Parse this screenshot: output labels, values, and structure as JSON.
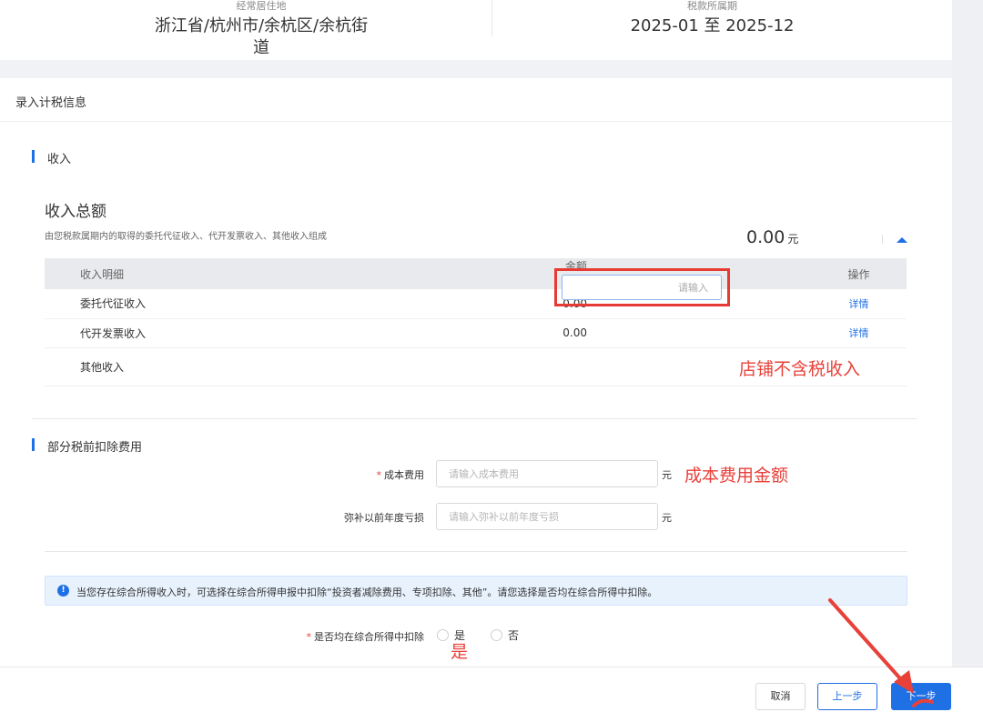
{
  "header": {
    "residence_label": "经常居住地",
    "residence_value": "浙江省/杭州市/余杭区/余杭街道",
    "period_label": "税款所属期",
    "period_value": "2025-01 至 2025-12"
  },
  "card": {
    "title": "录入计税信息"
  },
  "income": {
    "section_title": "收入",
    "total_title": "收入总额",
    "total_desc": "由您税款属期内的取得的委托代征收入、代开发票收入、其他收入组成",
    "total_amount": "0.00",
    "total_unit": "元",
    "table": {
      "headers": [
        "收入明细",
        "金额（元）",
        "操作"
      ],
      "rows": [
        {
          "name": "委托代征收入",
          "amount": "0.00",
          "action": "详情"
        },
        {
          "name": "代开发票收入",
          "amount": "0.00",
          "action": "详情"
        },
        {
          "name": "其他收入"
        }
      ],
      "other_input_placeholder": "请输入"
    }
  },
  "annotations": {
    "shop_income": "店铺不含税收入",
    "cost_amount": "成本费用金额",
    "yes": "是"
  },
  "deductions": {
    "section_title": "部分税前扣除费用",
    "cost_label": "成本费用",
    "cost_placeholder": "请输入成本费用",
    "cost_unit": "元",
    "loss_label": "弥补以前年度亏损",
    "loss_placeholder": "请输入弥补以前年度亏损",
    "loss_unit": "元"
  },
  "notice": {
    "icon": "!",
    "text": "当您存在综合所得收入时，可选择在综合所得申报中扣除“投资者减除费用、专项扣除、其他”。请您选择是否均在综合所得中扣除。"
  },
  "deduct_question": {
    "label": "是否均在综合所得中扣除",
    "option_yes": "是",
    "option_no": "否"
  },
  "footer": {
    "cancel": "取消",
    "prev": "上一步",
    "next": "下一步"
  },
  "colors": {
    "primary": "#1f6fe5",
    "annotation_red": "#e8413a"
  }
}
